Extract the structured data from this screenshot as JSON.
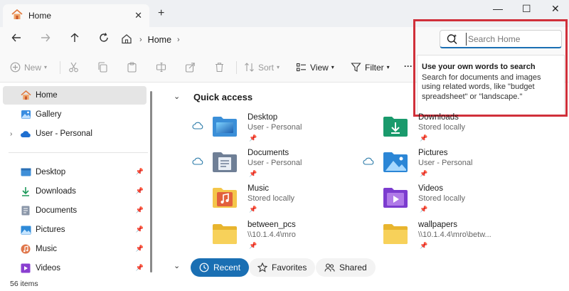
{
  "window": {
    "tab_title": "Home",
    "tab_close": "✕",
    "new_tab": "+",
    "minimize": "—",
    "maximize": "☐",
    "close": "✕"
  },
  "addressbar": {
    "path_label": "Home",
    "search_placeholder": "Search Home"
  },
  "toolbar": {
    "new_label": "New",
    "sort_label": "Sort",
    "view_label": "View",
    "filter_label": "Filter",
    "more_label": "···"
  },
  "tooltip": {
    "title": "Use your own words to search",
    "body": "Search for documents and images using related words, like \"budget spreadsheet\" or \"landscape.\""
  },
  "sidebar": {
    "items": [
      {
        "label": "Home",
        "icon": "home-icon"
      },
      {
        "label": "Gallery",
        "icon": "gallery-icon"
      },
      {
        "label": "User - Personal",
        "icon": "onedrive-icon"
      },
      {
        "label": "Desktop",
        "icon": "desktop-folder-icon"
      },
      {
        "label": "Downloads",
        "icon": "downloads-icon"
      },
      {
        "label": "Documents",
        "icon": "documents-icon"
      },
      {
        "label": "Pictures",
        "icon": "pictures-icon"
      },
      {
        "label": "Music",
        "icon": "music-icon"
      },
      {
        "label": "Videos",
        "icon": "videos-icon"
      }
    ]
  },
  "main": {
    "section_title": "Quick access",
    "quick_access": [
      {
        "name": "Desktop",
        "sub": "User - Personal",
        "icon": "desktop-folder-icon",
        "cloud": true
      },
      {
        "name": "Downloads",
        "sub": "Stored locally",
        "icon": "downloads-folder-icon",
        "cloud": false
      },
      {
        "name": "Documents",
        "sub": "User - Personal",
        "icon": "documents-folder-icon",
        "cloud": true
      },
      {
        "name": "Pictures",
        "sub": "User - Personal",
        "icon": "pictures-folder-icon",
        "cloud": true
      },
      {
        "name": "Music",
        "sub": "Stored locally",
        "icon": "music-folder-icon",
        "cloud": false
      },
      {
        "name": "Videos",
        "sub": "Stored locally",
        "icon": "videos-folder-icon",
        "cloud": false
      },
      {
        "name": "between_pcs",
        "sub": "\\\\10.1.4.4\\mro",
        "icon": "network-folder-icon",
        "cloud": false
      },
      {
        "name": "wallpapers",
        "sub": "\\\\10.1.4.4\\mro\\betw...",
        "icon": "network-folder-icon",
        "cloud": false
      }
    ],
    "tabs": [
      {
        "label": "Recent"
      },
      {
        "label": "Favorites"
      },
      {
        "label": "Shared"
      }
    ]
  },
  "status": {
    "items_count": "56 items"
  },
  "colors": {
    "accent": "#1a6fb3",
    "highlight": "#d0303a",
    "folder_yellow": "#f5c842"
  }
}
